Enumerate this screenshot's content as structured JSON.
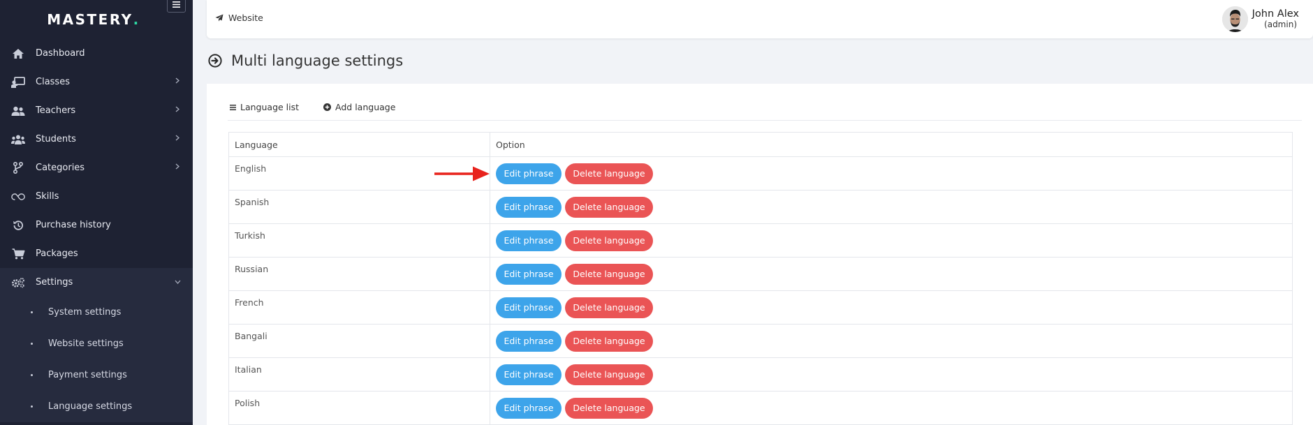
{
  "brand": {
    "name": "MASTERY",
    "dot": "."
  },
  "sidebar": {
    "items": [
      {
        "label": "Dashboard",
        "icon": "home-icon",
        "chevron": false
      },
      {
        "label": "Classes",
        "icon": "classroom-icon",
        "chevron": true
      },
      {
        "label": "Teachers",
        "icon": "users-icon",
        "chevron": true
      },
      {
        "label": "Students",
        "icon": "students-icon",
        "chevron": true
      },
      {
        "label": "Categories",
        "icon": "branch-icon",
        "chevron": true
      },
      {
        "label": "Skills",
        "icon": "skills-icon",
        "chevron": false
      },
      {
        "label": "Purchase history",
        "icon": "history-icon",
        "chevron": false
      },
      {
        "label": "Packages",
        "icon": "cart-icon",
        "chevron": false
      },
      {
        "label": "Settings",
        "icon": "gears-icon",
        "chevron": true,
        "expanded": true
      }
    ],
    "subitems": [
      {
        "label": "System settings"
      },
      {
        "label": "Website settings"
      },
      {
        "label": "Payment settings"
      },
      {
        "label": "Language settings"
      }
    ]
  },
  "topbar": {
    "website_label": "Website",
    "user_name": "John Alex",
    "user_role": "(admin)"
  },
  "page": {
    "title": "Multi language settings"
  },
  "tabs": [
    {
      "label": "Language list",
      "icon": "list-icon"
    },
    {
      "label": "Add language",
      "icon": "plus-circle-icon"
    }
  ],
  "table": {
    "columns": [
      "Language",
      "Option"
    ],
    "rows": [
      {
        "language": "English"
      },
      {
        "language": "Spanish"
      },
      {
        "language": "Turkish"
      },
      {
        "language": "Russian"
      },
      {
        "language": "French"
      },
      {
        "language": "Bangali"
      },
      {
        "language": "Italian"
      },
      {
        "language": "Polish"
      }
    ],
    "edit_label": "Edit phrase",
    "delete_label": "Delete language"
  },
  "colors": {
    "sidebar_bg": "#1e2233",
    "accent": "#2ed8a3",
    "edit_button": "#3da4ea",
    "delete_button": "#ea5455",
    "annotation_arrow": "#e8231d"
  }
}
